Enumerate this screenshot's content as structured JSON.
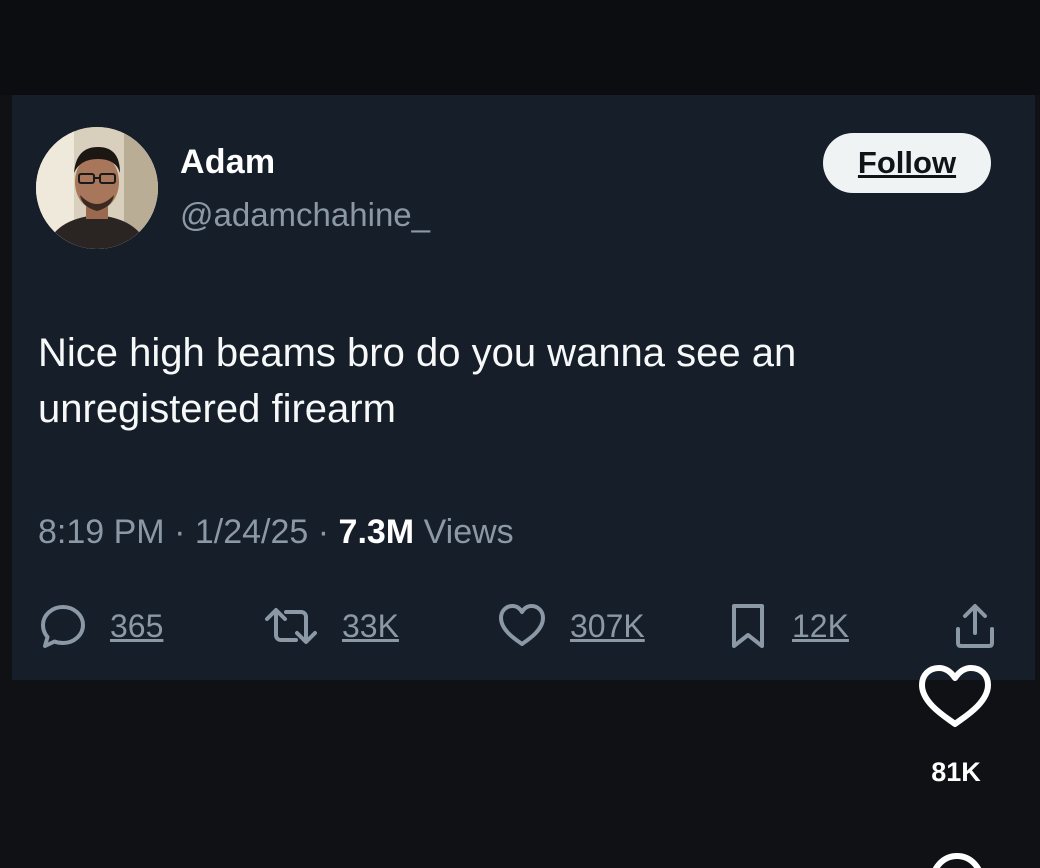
{
  "tweet": {
    "author": {
      "display_name": "Adam",
      "handle": "@adamchahine_"
    },
    "follow_label": "Follow",
    "text": "Nice high beams bro do you wanna see an unregistered firearm",
    "time": "8:19 PM",
    "date": "1/24/25",
    "separator": "·",
    "views_count": "7.3M",
    "views_label": "Views",
    "actions": {
      "replies": "365",
      "reposts": "33K",
      "likes": "307K",
      "bookmarks": "12K"
    },
    "icons": {
      "reply": "reply-icon",
      "repost": "repost-icon",
      "like": "heart-icon",
      "bookmark": "bookmark-icon",
      "share": "share-icon"
    }
  },
  "side_panel": {
    "like_count": "81K",
    "like_icon": "heart-icon"
  },
  "colors": {
    "background": "#0f1115",
    "card": "#161e29",
    "text_primary": "#f7f9f9",
    "text_secondary": "#8b98a5",
    "follow_button": "#eff3f4"
  }
}
